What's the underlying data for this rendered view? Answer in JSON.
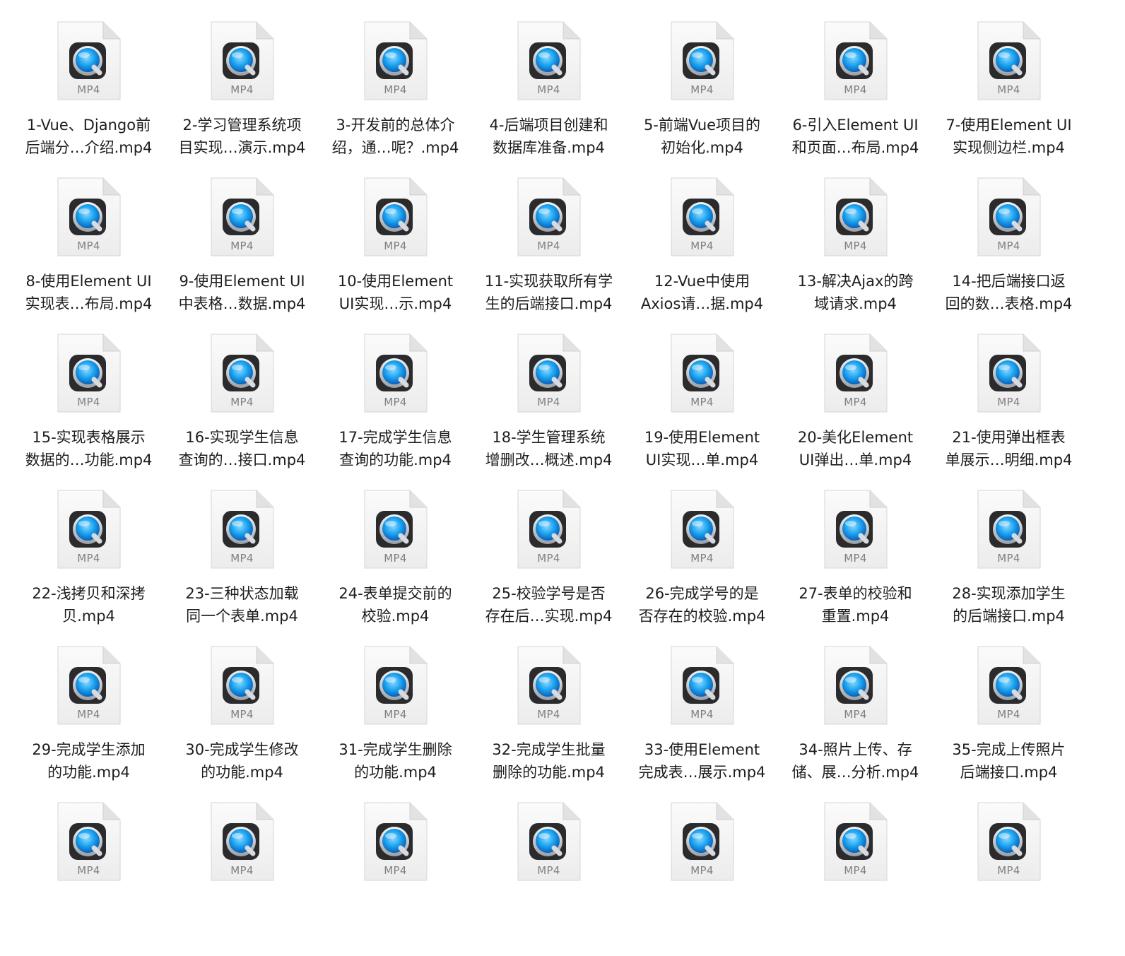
{
  "window": {
    "view": "icon-grid",
    "icon": "quicktime-mp4-file-icon",
    "colors": {
      "background": "#ffffff",
      "label_text": "#1d1d1f",
      "ext_text": "#7f7f84",
      "qt_blue": "#1aa3f0"
    }
  },
  "files": [
    {
      "line1": "1-Vue、Django前",
      "line2": "后端分…介绍.mp4",
      "ext": "MP4"
    },
    {
      "line1": "2-学习管理系统项",
      "line2": "目实现…演示.mp4",
      "ext": "MP4"
    },
    {
      "line1": "3-开发前的总体介",
      "line2": "绍，通…呢？.mp4",
      "ext": "MP4"
    },
    {
      "line1": "4-后端项目创建和",
      "line2": "数据库准备.mp4",
      "ext": "MP4"
    },
    {
      "line1": "5-前端Vue项目的",
      "line2": "初始化.mp4",
      "ext": "MP4"
    },
    {
      "line1": "6-引入Element UI",
      "line2": "和页面…布局.mp4",
      "ext": "MP4"
    },
    {
      "line1": "7-使用Element UI",
      "line2": "实现侧边栏.mp4",
      "ext": "MP4"
    },
    {
      "line1": "8-使用Element UI",
      "line2": "实现表…布局.mp4",
      "ext": "MP4"
    },
    {
      "line1": "9-使用Element UI",
      "line2": "中表格…数据.mp4",
      "ext": "MP4"
    },
    {
      "line1": "10-使用Element",
      "line2": "UI实现…示.mp4",
      "ext": "MP4"
    },
    {
      "line1": "11-实现获取所有学",
      "line2": "生的后端接口.mp4",
      "ext": "MP4"
    },
    {
      "line1": "12-Vue中使用",
      "line2": "Axios请…据.mp4",
      "ext": "MP4"
    },
    {
      "line1": "13-解决Ajax的跨",
      "line2": "域请求.mp4",
      "ext": "MP4"
    },
    {
      "line1": "14-把后端接口返",
      "line2": "回的数…表格.mp4",
      "ext": "MP4"
    },
    {
      "line1": "15-实现表格展示",
      "line2": "数据的…功能.mp4",
      "ext": "MP4"
    },
    {
      "line1": "16-实现学生信息",
      "line2": "查询的…接口.mp4",
      "ext": "MP4"
    },
    {
      "line1": "17-完成学生信息",
      "line2": "查询的功能.mp4",
      "ext": "MP4"
    },
    {
      "line1": "18-学生管理系统",
      "line2": "增删改…概述.mp4",
      "ext": "MP4"
    },
    {
      "line1": "19-使用Element",
      "line2": "UI实现…单.mp4",
      "ext": "MP4"
    },
    {
      "line1": "20-美化Element",
      "line2": "UI弹出…单.mp4",
      "ext": "MP4"
    },
    {
      "line1": "21-使用弹出框表",
      "line2": "单展示…明细.mp4",
      "ext": "MP4"
    },
    {
      "line1": "22-浅拷贝和深拷",
      "line2": "贝.mp4",
      "ext": "MP4"
    },
    {
      "line1": "23-三种状态加载",
      "line2": "同一个表单.mp4",
      "ext": "MP4"
    },
    {
      "line1": "24-表单提交前的",
      "line2": "校验.mp4",
      "ext": "MP4"
    },
    {
      "line1": "25-校验学号是否",
      "line2": "存在后…实现.mp4",
      "ext": "MP4"
    },
    {
      "line1": "26-完成学号的是",
      "line2": "否存在的校验.mp4",
      "ext": "MP4"
    },
    {
      "line1": "27-表单的校验和",
      "line2": "重置.mp4",
      "ext": "MP4"
    },
    {
      "line1": "28-实现添加学生",
      "line2": "的后端接口.mp4",
      "ext": "MP4"
    },
    {
      "line1": "29-完成学生添加",
      "line2": "的功能.mp4",
      "ext": "MP4"
    },
    {
      "line1": "30-完成学生修改",
      "line2": "的功能.mp4",
      "ext": "MP4"
    },
    {
      "line1": "31-完成学生删除",
      "line2": "的功能.mp4",
      "ext": "MP4"
    },
    {
      "line1": "32-完成学生批量",
      "line2": "删除的功能.mp4",
      "ext": "MP4"
    },
    {
      "line1": "33-使用Element",
      "line2": "完成表…展示.mp4",
      "ext": "MP4"
    },
    {
      "line1": "34-照片上传、存",
      "line2": "储、展…分析.mp4",
      "ext": "MP4"
    },
    {
      "line1": "35-完成上传照片",
      "line2": "后端接口.mp4",
      "ext": "MP4"
    },
    {
      "line1": "",
      "line2": "",
      "ext": "MP4"
    },
    {
      "line1": "",
      "line2": "",
      "ext": "MP4"
    },
    {
      "line1": "",
      "line2": "",
      "ext": "MP4"
    },
    {
      "line1": "",
      "line2": "",
      "ext": "MP4"
    },
    {
      "line1": "",
      "line2": "",
      "ext": "MP4"
    },
    {
      "line1": "",
      "line2": "",
      "ext": "MP4"
    },
    {
      "line1": "",
      "line2": "",
      "ext": "MP4"
    }
  ]
}
